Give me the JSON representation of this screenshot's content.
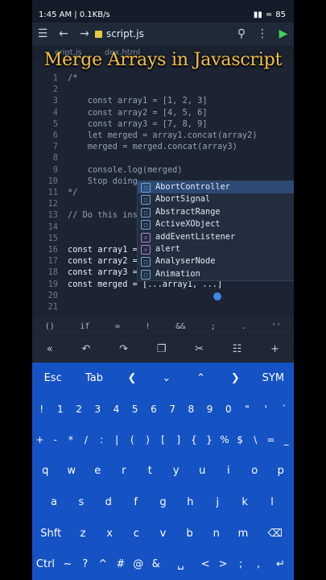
{
  "status": {
    "time_info": "1:45 AM | 0.1KB/s",
    "battery": "85"
  },
  "toolbar": {
    "filename": "script.js"
  },
  "tabs": [
    {
      "label": "cript.js"
    },
    {
      "label": "dex.html"
    }
  ],
  "banner": {
    "title": "Merge Arrays in Javascript"
  },
  "editor": {
    "lines": [
      {
        "n": "1",
        "text": "/*",
        "kind": "comment"
      },
      {
        "n": "2",
        "text": "",
        "kind": "comment"
      },
      {
        "n": "3",
        "text": "    const array1 = [1, 2, 3]",
        "kind": "comment"
      },
      {
        "n": "4",
        "text": "    const array2 = [4, 5, 6]",
        "kind": "comment"
      },
      {
        "n": "5",
        "text": "    const array3 = [7, 8, 9]",
        "kind": "comment"
      },
      {
        "n": "6",
        "text": "    let merged = array1.concat(array2)",
        "kind": "comment"
      },
      {
        "n": "7",
        "text": "    merged = merged.concat(array3)",
        "kind": "comment"
      },
      {
        "n": "8",
        "text": "",
        "kind": "comment"
      },
      {
        "n": "9",
        "text": "    console.log(merged)",
        "kind": "comment"
      },
      {
        "n": "10",
        "text": "    Stop doing",
        "kind": "comment"
      },
      {
        "n": "11",
        "text": "*/",
        "kind": "comment"
      },
      {
        "n": "12",
        "text": "",
        "kind": "plain"
      },
      {
        "n": "13",
        "text": "// Do this ins",
        "kind": "comment"
      },
      {
        "n": "14",
        "text": "",
        "kind": "plain"
      },
      {
        "n": "15",
        "text": "",
        "kind": "plain"
      },
      {
        "n": "16",
        "text": "const array1 =",
        "kind": "kw"
      },
      {
        "n": "17",
        "text": "const array2 =",
        "kind": "kw"
      },
      {
        "n": "18",
        "text": "const array3 =",
        "kind": "kw"
      },
      {
        "n": "19",
        "text": "const merged = [...array1, ...]",
        "kind": "kw"
      },
      {
        "n": "20",
        "text": "",
        "kind": "plain"
      },
      {
        "n": "21",
        "text": "",
        "kind": "plain"
      }
    ]
  },
  "autocomplete": {
    "items": [
      {
        "label": "AbortController",
        "icon": "class-icon",
        "selected": true
      },
      {
        "label": "AbortSignal",
        "icon": "class-icon"
      },
      {
        "label": "AbstractRange",
        "icon": "class-icon"
      },
      {
        "label": "ActiveXObject",
        "icon": "class-icon"
      },
      {
        "label": "addEventListener",
        "icon": "function-icon"
      },
      {
        "label": "alert",
        "icon": "function-icon"
      },
      {
        "label": "AnalyserNode",
        "icon": "class-icon"
      },
      {
        "label": "Animation",
        "icon": "class-icon"
      }
    ]
  },
  "symbolbar": [
    "()",
    "if",
    "=",
    "!",
    "&&",
    ";",
    ".",
    "''"
  ],
  "keyboard": {
    "row1": [
      "Esc",
      "Tab",
      "❮",
      "⌄",
      "⌃",
      "❯",
      "SYM"
    ],
    "row2": [
      "!",
      "1",
      "2",
      "3",
      "4",
      "5",
      "6",
      "7",
      "8",
      "9",
      "0",
      "\"",
      "'",
      "`"
    ],
    "row3": [
      "+",
      "-",
      "*",
      "/",
      ":",
      "|",
      "(",
      ")",
      "[",
      "]",
      "{",
      "}",
      "%",
      "$",
      "\\",
      "=",
      "_"
    ],
    "row4": [
      "q",
      "w",
      "e",
      "r",
      "t",
      "y",
      "u",
      "i",
      "o",
      "p"
    ],
    "row5": [
      "a",
      "s",
      "d",
      "f",
      "g",
      "h",
      "j",
      "k",
      "l"
    ],
    "row6": [
      "Shft",
      "z",
      "x",
      "c",
      "v",
      "b",
      "n",
      "m",
      "⌫"
    ],
    "row7": [
      "Ctrl",
      "~",
      "?",
      "^",
      "#",
      "@",
      "&",
      "␣",
      "<",
      ">",
      ";",
      ",",
      "↵"
    ]
  }
}
